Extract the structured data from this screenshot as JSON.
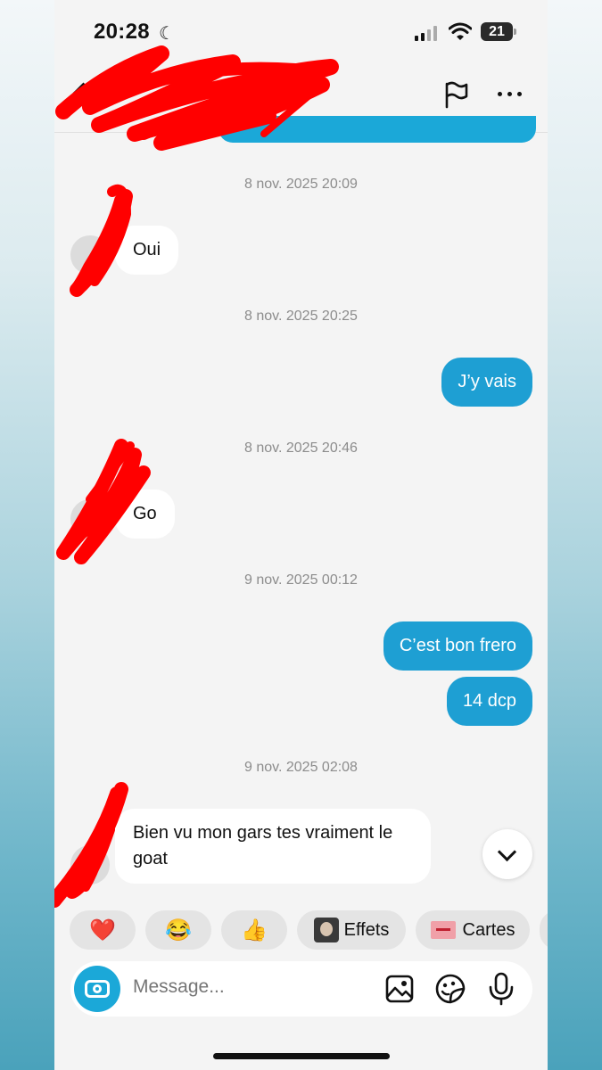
{
  "status_bar": {
    "time": "20:28",
    "battery": "21"
  },
  "conversation": {
    "messages": [
      {
        "type": "timestamp",
        "text": "8 nov. 2025 20:09"
      },
      {
        "type": "in",
        "text": "Oui"
      },
      {
        "type": "timestamp",
        "text": "8 nov. 2025 20:25"
      },
      {
        "type": "out",
        "text": "J’y vais"
      },
      {
        "type": "timestamp",
        "text": "8 nov. 2025 20:46"
      },
      {
        "type": "in",
        "text": "Go"
      },
      {
        "type": "timestamp",
        "text": "9 nov. 2025 00:12"
      },
      {
        "type": "out",
        "text": "C’est bon frero"
      },
      {
        "type": "out",
        "text": "14 dcp"
      },
      {
        "type": "timestamp",
        "text": "9 nov. 2025 02:08"
      },
      {
        "type": "in",
        "text": "Bien vu mon gars tes vraiment le goat"
      }
    ]
  },
  "quick_actions": [
    {
      "icon": "❤️",
      "name": "heart"
    },
    {
      "icon": "😂",
      "name": "laugh"
    },
    {
      "icon": "👍",
      "name": "thumbs-up"
    },
    {
      "label": "Effets"
    },
    {
      "label": "Cartes"
    }
  ],
  "composer": {
    "placeholder": "Message..."
  },
  "colors": {
    "outgoing_bubble": "#1e9fd3",
    "accent": "#1ba8d8"
  }
}
